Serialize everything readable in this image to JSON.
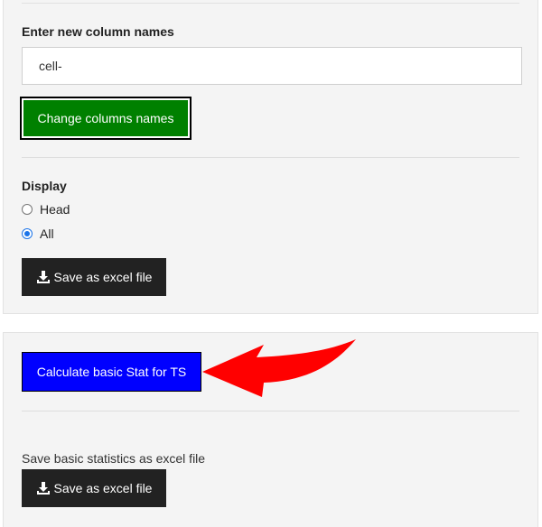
{
  "column_names": {
    "label": "Enter new column names",
    "input_value": "cell-",
    "change_button_label": "Change columns names",
    "change_button_color": "#008000"
  },
  "display": {
    "label": "Display",
    "options": [
      {
        "label": "Head",
        "selected": false
      },
      {
        "label": "All",
        "selected": true
      }
    ],
    "save_button_label": "Save as excel file"
  },
  "stats": {
    "calculate_button_label": "Calculate basic Stat for TS",
    "calculate_button_color": "#0000ff",
    "save_caption": "Save basic statistics as excel file",
    "save_button_label": "Save as excel file"
  },
  "annotation": {
    "arrow_color": "#ff0000",
    "arrow_icon": "red-arrow-icon"
  }
}
